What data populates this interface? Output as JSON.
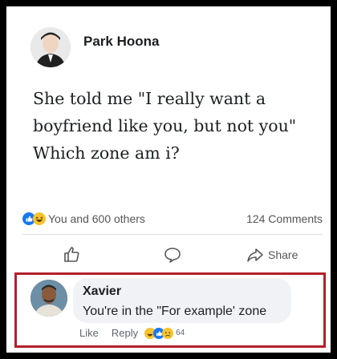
{
  "post": {
    "author": "Park Hoona",
    "text_lines": [
      "She told me \"I really want a",
      "boyfriend like you, but not you\"",
      "Which zone am i?"
    ],
    "reactions_text": "You and 600 others",
    "comments_count": "124 Comments",
    "reaction_icons": [
      "like-icon",
      "haha-icon"
    ]
  },
  "actions": {
    "share_label": "Share"
  },
  "comment": {
    "author": "Xavier",
    "text": "You're in the \"For example' zone",
    "like_label": "Like",
    "reply_label": "Reply",
    "reaction_count": "64",
    "reaction_icons": [
      "haha-icon",
      "like-icon",
      "sad-icon"
    ]
  },
  "colors": {
    "highlight_border": "#b3202a",
    "like_blue": "#1877f2",
    "emoji_yellow": "#f7c32e"
  }
}
